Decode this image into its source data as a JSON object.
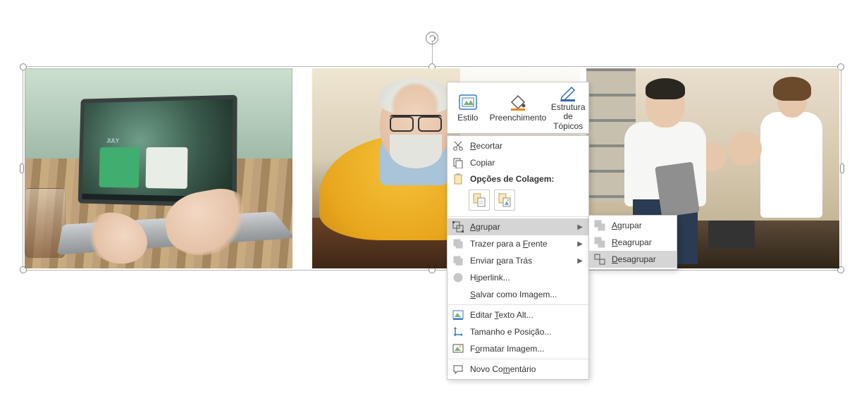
{
  "mini_toolbar": {
    "style": "Estilo",
    "fill": "Preenchimento",
    "outline": "Estrutura de Tópicos"
  },
  "context_menu": {
    "cut": "Recortar",
    "copy": "Copiar",
    "paste_options_header": "Opções de Colagem:",
    "group": "Agrupar",
    "bring_front": "Trazer para a Frente",
    "send_back": "Enviar para Trás",
    "hyperlink": "Hiperlink...",
    "save_as_image": "Salvar como Imagem...",
    "edit_alt_text": "Editar Texto Alt...",
    "size_position": "Tamanho e Posição...",
    "format_picture": "Formatar Imagem...",
    "new_comment": "Novo Comentário"
  },
  "submenu": {
    "group": "Agrupar",
    "regroup": "Reagrupar",
    "ungroup": "Desagrupar"
  }
}
